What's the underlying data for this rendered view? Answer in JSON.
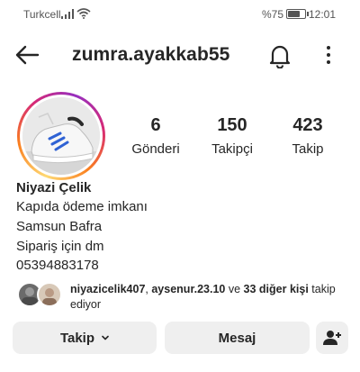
{
  "status_bar": {
    "carrier": "Turkcell",
    "battery_text": "%75",
    "battery_level": 0.75,
    "time": "12:01"
  },
  "header": {
    "username": "zumra.ayakkab55"
  },
  "stats": {
    "posts": {
      "value": "6",
      "label": "Gönderi"
    },
    "followers": {
      "value": "150",
      "label": "Takipçi"
    },
    "following": {
      "value": "423",
      "label": "Takip"
    }
  },
  "bio": {
    "display_name": "Niyazi Çelik",
    "lines": [
      "Kapıda ödeme imkanı",
      "Samsun Bafra",
      "Sipariş için dm",
      "05394883178"
    ]
  },
  "mutual": {
    "user1": "niyazicelik407",
    "sep": ", ",
    "user2": "aysenur.23.10",
    "and": " ve ",
    "others": "33 diğer kişi",
    "suffix": " takip ediyor"
  },
  "buttons": {
    "follow": "Takip",
    "message": "Mesaj"
  },
  "icons": {
    "back": "arrow-left-icon",
    "bell": "bell-icon",
    "more": "more-vertical-icon",
    "add_user": "add-user-icon"
  }
}
